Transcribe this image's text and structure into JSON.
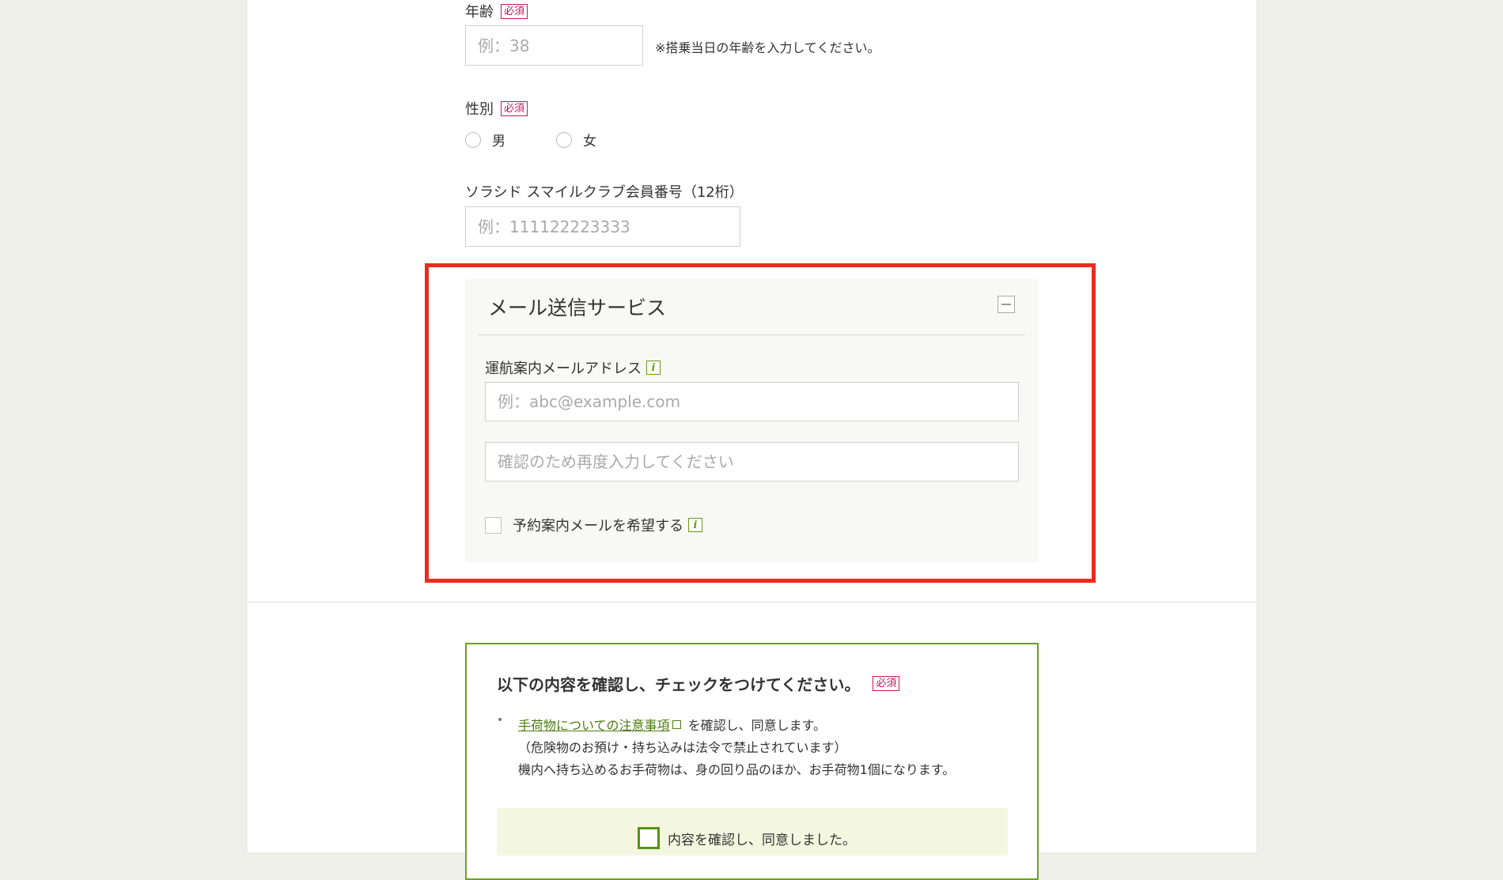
{
  "form": {
    "age": {
      "label": "年齢",
      "required_badge": "必須",
      "placeholder": "例：38",
      "note": "※搭乗当日の年齢を入力してください。"
    },
    "gender": {
      "label": "性別",
      "required_badge": "必須",
      "options": [
        "男",
        "女"
      ]
    },
    "member_number": {
      "label": "ソラシド スマイルクラブ会員番号（12桁）",
      "placeholder": "例：111122223333"
    }
  },
  "mail_service": {
    "title": "メール送信サービス",
    "email_label": "運航案内メールアドレス",
    "email_placeholder": "例：abc@example.com",
    "confirm_placeholder": "確認のため再度入力してください",
    "reservation_mail_label": "予約案内メールを希望する",
    "info_icon_glyph": "i"
  },
  "confirm": {
    "title": "以下の内容を確認し、チェックをつけてください。",
    "required_badge": "必須",
    "bullet": "•",
    "link_text": "手荷物についての注意事項",
    "line1_suffix": "を確認し、同意します。",
    "line2": "（危険物のお預け・持ち込みは法令で禁止されています）",
    "line3": "機内へ持ち込めるお手荷物は、身の回り品のほか、お手荷物1個になります。",
    "agree_label": "内容を確認し、同意しました。"
  },
  "colors": {
    "highlight": "#ee2a1c",
    "accent_green": "#6aa21f",
    "required_red": "#c2185b"
  }
}
